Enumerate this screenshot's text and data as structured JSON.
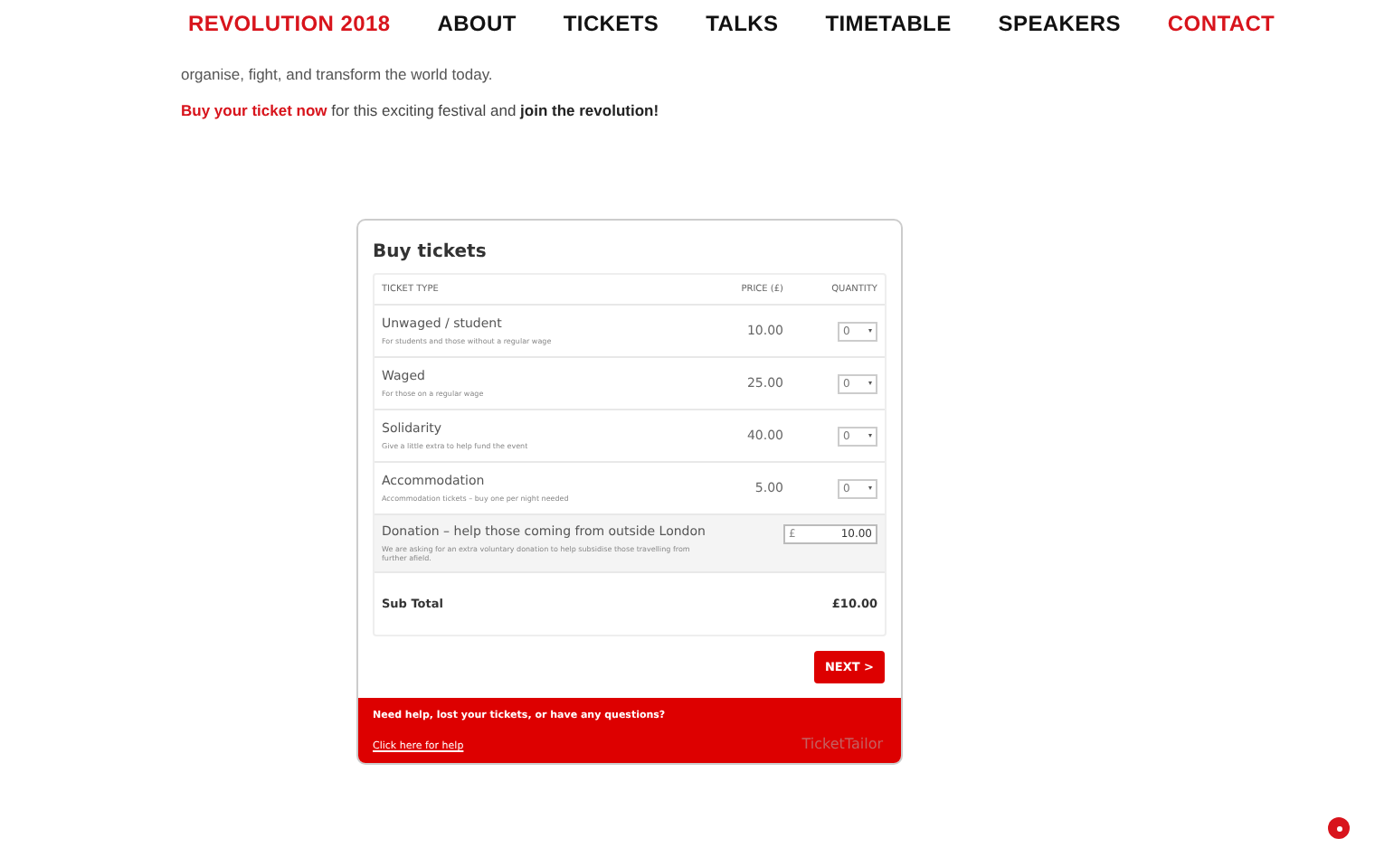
{
  "nav": [
    {
      "label": "REVOLUTION 2018",
      "selected": true
    },
    {
      "label": "ABOUT",
      "selected": false
    },
    {
      "label": "TICKETS",
      "selected": false
    },
    {
      "label": "TALKS",
      "selected": false
    },
    {
      "label": "TIMETABLE",
      "selected": false
    },
    {
      "label": "SPEAKERS",
      "selected": false
    },
    {
      "label": "CONTACT",
      "selected": true
    }
  ],
  "intro": "organise, fight, and transform the world today.",
  "cta": "**Buy your ticket now** for this exciting festival and **join the revolution!**",
  "widget": {
    "title": "Buy tickets",
    "columns": [
      "TICKET TYPE",
      "PRICE (£)",
      "QUANTITY"
    ],
    "tickets": [
      {
        "name": "Unwaged / student",
        "note": "For students and those without a regular wage",
        "price": "10.00",
        "quantity": "0"
      },
      {
        "name": "Waged",
        "note": "For those on a regular wage",
        "price": "25.00",
        "quantity": "0"
      },
      {
        "name": "Solidarity",
        "note": "Give a little extra to help fund the event",
        "price": "40.00",
        "quantity": "0"
      },
      {
        "name": "Accommodation",
        "note": "Accommodation tickets – buy one per night needed",
        "price": "5.00",
        "quantity": "0"
      }
    ],
    "donation": {
      "name": "Donation – help those coming from outside London",
      "note": "We are asking for an extra voluntary donation to help subsidise those travelling from further afield.",
      "currency": "£",
      "value": "10.00"
    },
    "subtotal": {
      "label": "Sub Total",
      "value": "£10.00"
    },
    "next_button": "NEXT >",
    "footer": {
      "question": "Need help, lost your tickets, or have any questions?",
      "link": "Click here for help",
      "brand": "TicketTailor"
    }
  }
}
